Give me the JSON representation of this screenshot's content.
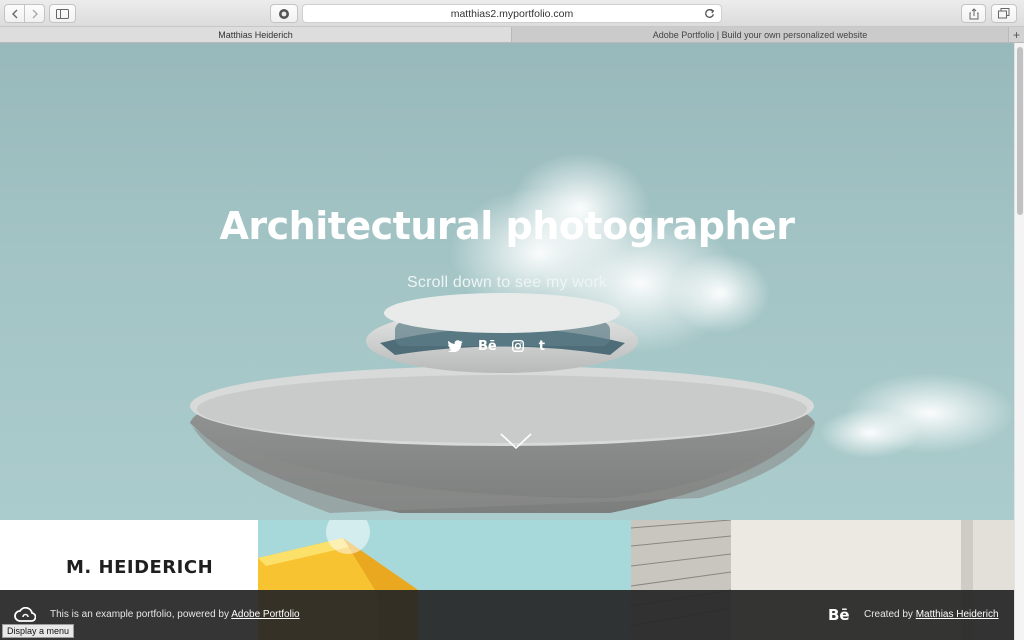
{
  "browser": {
    "url": "matthias2.myportfolio.com",
    "tabs": [
      {
        "label": "Matthias Heiderich"
      },
      {
        "label": "Adobe Portfolio | Build your own personalized website"
      }
    ],
    "new_tab_label": "+"
  },
  "hero": {
    "title": "Architectural photographer",
    "subtitle": "Scroll down to see my work",
    "social": [
      {
        "icon": "twitter-icon",
        "label": ""
      },
      {
        "icon": "behance-icon",
        "label": "Bē"
      },
      {
        "icon": "instagram-icon",
        "label": ""
      },
      {
        "icon": "tumblr-icon",
        "label": "t"
      }
    ]
  },
  "section": {
    "brand": "M. HEIDERICH"
  },
  "footer": {
    "left_text": "This is an example portfolio, powered by ",
    "left_link": "Adobe Portfolio",
    "behance_mark": "Bē",
    "right_text": "Created by ",
    "right_link": "Matthias Heiderich"
  },
  "tooltip": "Display a menu",
  "colors": {
    "sky": "#a3c4c5",
    "footer_bg": "#262626",
    "title": "#ffffff"
  }
}
